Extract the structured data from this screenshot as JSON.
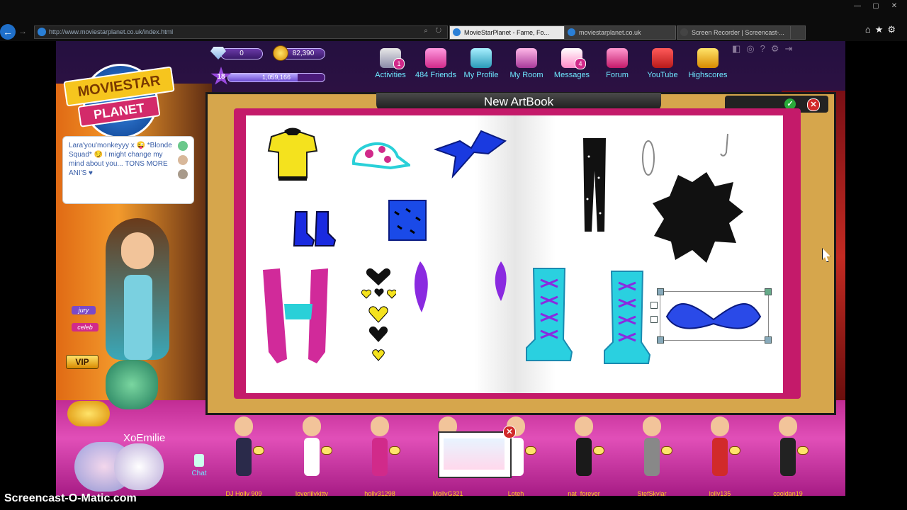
{
  "browser": {
    "url": "http://www.moviestarplanet.co.uk/index.html",
    "tabs": [
      {
        "label": "MovieStarPlanet - Fame, Fo...",
        "active": true
      },
      {
        "label": "moviestarplanet.co.uk",
        "active": false
      },
      {
        "label": "Screen Recorder | Screencast-...",
        "active": false
      }
    ]
  },
  "hud": {
    "diamonds": "0",
    "starcoins": "82,390",
    "level": "18",
    "fame": "1,059,166",
    "fame_progress": 0.72
  },
  "nav": {
    "activities": "Activities",
    "activities_badge": "1",
    "friends": "484 Friends",
    "my_profile": "My Profile",
    "my_room": "My Room",
    "messages": "Messages",
    "messages_badge": "4",
    "forum": "Forum",
    "youtube": "YouTube",
    "highscores": "Highscores"
  },
  "logo": {
    "line1": "MOVIESTAR",
    "line2": "PLANET"
  },
  "chat_bubble": {
    "text": "Lara'you'monkeyyy x 😜 *Blonde Squad* 😏 I might change my mind about you... TONS MORE ANI'S ♥"
  },
  "player": {
    "username": "XoEmilie",
    "tag_jury": "jury",
    "tag_celeb": "celeb",
    "vip": "VIP",
    "chat_label": "Chat"
  },
  "artbook": {
    "title": "New ArtBook"
  },
  "friends": [
    "DJ Holly 909",
    "loverlilykitty",
    "holly31298",
    "MollyG321",
    "Loteh",
    "nat_forever",
    "StefSkylar",
    "lolly135",
    "cooldan19"
  ],
  "colors": {
    "accent_cyan": "#6ee7ff",
    "cover_pink": "#c41a6a",
    "floor_pink": "#e14fb8",
    "frame_gold": "#d6a64c"
  },
  "watermark": "Screencast-O-Matic.com"
}
